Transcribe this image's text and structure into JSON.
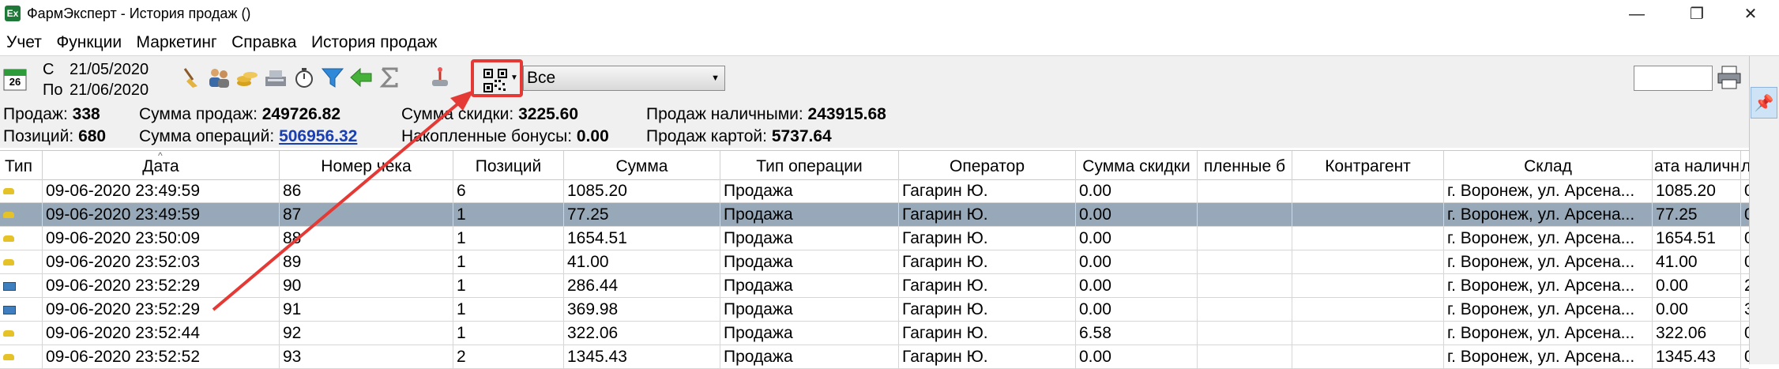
{
  "window": {
    "title": "ФармЭксперт - История продаж ()",
    "app_icon_text": "Ex",
    "controls": {
      "minimize": "—",
      "maximize": "❐",
      "close": "✕"
    }
  },
  "menu": [
    "Учет",
    "Функции",
    "Маркетинг",
    "Справка",
    "История продаж"
  ],
  "toolbar": {
    "calendar_day": "26",
    "from_label": "С",
    "from_date": "21/05/2020",
    "to_label": "По",
    "to_date": "21/06/2020",
    "filter_value": "Все",
    "right_input_value": ""
  },
  "summary": {
    "sales_label": "Продаж:",
    "sales_value": "338",
    "positions_label": "Позиций:",
    "positions_value": "680",
    "sales_sum_label": "Сумма продаж:",
    "sales_sum_value": "249726.82",
    "ops_sum_label": "Сумма операций:",
    "ops_sum_value": "506956.32",
    "discount_sum_label": "Сумма скидки:",
    "discount_sum_value": "3225.60",
    "bonus_label": "Накопленные бонусы:",
    "bonus_value": "0.00",
    "cash_label": "Продаж наличными:",
    "cash_value": "243915.68",
    "card_label": "Продаж картой:",
    "card_value": "5737.64"
  },
  "table": {
    "columns": [
      "Тип",
      "Дата",
      "Номер чека",
      "Позиций",
      "Сумма",
      "Тип операции",
      "Оператор",
      "Сумма скидки",
      "пленные б",
      "Контрагент",
      "Склад",
      "ата наличн",
      "л"
    ],
    "rows": [
      {
        "type": "cash",
        "cells": [
          "09-06-2020 23:49:59",
          "86",
          "6",
          "1085.20",
          "Продажа",
          "Гагарин Ю.",
          "0.00",
          "",
          "",
          "г. Воронеж, ул. Арсена...",
          "1085.20",
          "0"
        ]
      },
      {
        "type": "cash",
        "selected": true,
        "cells": [
          "09-06-2020 23:49:59",
          "87",
          "1",
          "77.25",
          "Продажа",
          "Гагарин Ю.",
          "0.00",
          "",
          "",
          "г. Воронеж, ул. Арсена...",
          "77.25",
          "0"
        ]
      },
      {
        "type": "cash",
        "cells": [
          "09-06-2020 23:50:09",
          "88",
          "1",
          "1654.51",
          "Продажа",
          "Гагарин Ю.",
          "0.00",
          "",
          "",
          "г. Воронеж, ул. Арсена...",
          "1654.51",
          "0"
        ]
      },
      {
        "type": "cash",
        "cells": [
          "09-06-2020 23:52:03",
          "89",
          "1",
          "41.00",
          "Продажа",
          "Гагарин Ю.",
          "0.00",
          "",
          "",
          "г. Воронеж, ул. Арсена...",
          "41.00",
          "0"
        ]
      },
      {
        "type": "card",
        "cells": [
          "09-06-2020 23:52:29",
          "90",
          "1",
          "286.44",
          "Продажа",
          "Гагарин Ю.",
          "0.00",
          "",
          "",
          "г. Воронеж, ул. Арсена...",
          "0.00",
          "2"
        ]
      },
      {
        "type": "card",
        "cells": [
          "09-06-2020 23:52:29",
          "91",
          "1",
          "369.98",
          "Продажа",
          "Гагарин Ю.",
          "0.00",
          "",
          "",
          "г. Воронеж, ул. Арсена...",
          "0.00",
          "3"
        ]
      },
      {
        "type": "cash",
        "cells": [
          "09-06-2020 23:52:44",
          "92",
          "1",
          "322.06",
          "Продажа",
          "Гагарин Ю.",
          "6.58",
          "",
          "",
          "г. Воронеж, ул. Арсена...",
          "322.06",
          "0"
        ]
      },
      {
        "type": "cash",
        "cells": [
          "09-06-2020 23:52:52",
          "93",
          "2",
          "1345.43",
          "Продажа",
          "Гагарин Ю.",
          "0.00",
          "",
          "",
          "г. Воронеж, ул. Арсена...",
          "1345.43",
          "0"
        ]
      }
    ]
  },
  "annotation": {
    "color": "#e53935"
  }
}
